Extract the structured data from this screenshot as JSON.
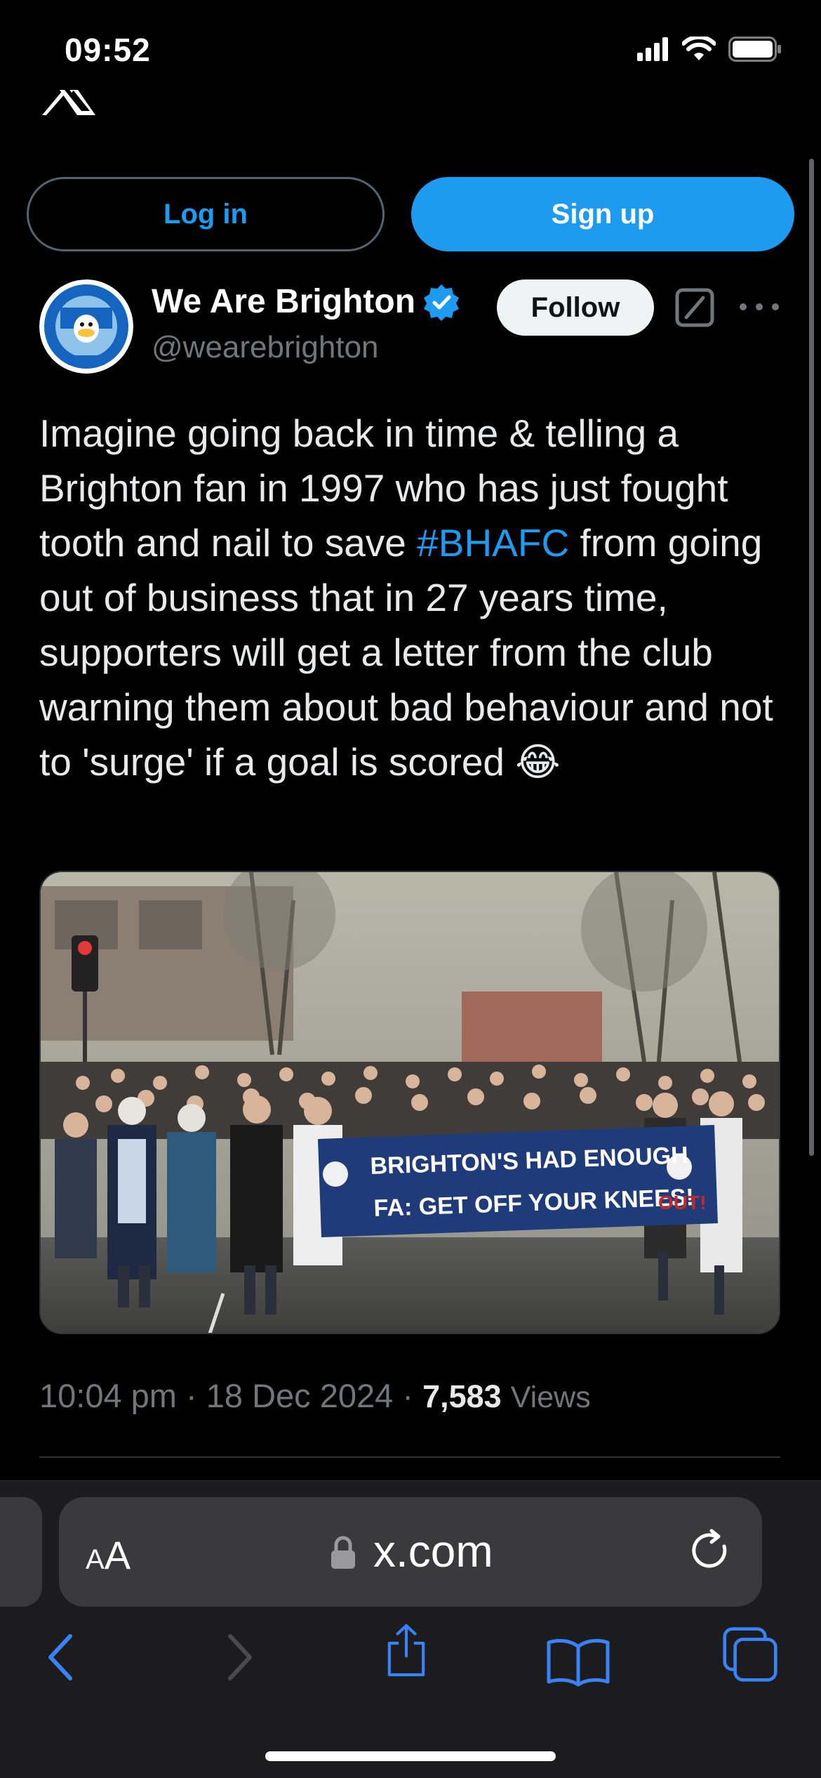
{
  "status_bar": {
    "time": "09:52"
  },
  "auth": {
    "login_label": "Log in",
    "signup_label": "Sign up"
  },
  "author": {
    "name": "We Are Brighton",
    "handle": "@wearebrighton",
    "follow_label": "Follow",
    "verified": true
  },
  "tweet": {
    "text_before": "Imagine going back in time & telling a Brighton fan in 1997 who has just fought tooth and nail to save ",
    "hashtag": "#BHAFC",
    "text_after": " from going out of business that in 27 years time, supporters will get a letter from the club warning them about bad behaviour and not to 'surge' if a goal is scored ",
    "emoji": "😂"
  },
  "photo": {
    "banner_line1": "BRIGHTON'S HAD ENOUGH",
    "banner_line2": "FA: GET OFF YOUR KNEES!",
    "banner_right": "OUT!"
  },
  "meta": {
    "time": "10:04 pm",
    "date": "18 Dec 2024",
    "views_count": "7,583",
    "views_label": "Views",
    "separator": "·"
  },
  "browser": {
    "aa_small": "A",
    "aa_big": "A",
    "url": "x.com"
  },
  "colors": {
    "accent": "#1d9bf0",
    "background": "#000000",
    "muted": "#71767b"
  },
  "icons": [
    "x-logo-icon",
    "signal-icon",
    "wifi-icon",
    "battery-icon",
    "verified-badge-icon",
    "grok-icon",
    "more-icon",
    "lock-icon",
    "reload-icon",
    "back-icon",
    "forward-icon",
    "share-icon",
    "bookmarks-icon",
    "tabs-icon"
  ]
}
